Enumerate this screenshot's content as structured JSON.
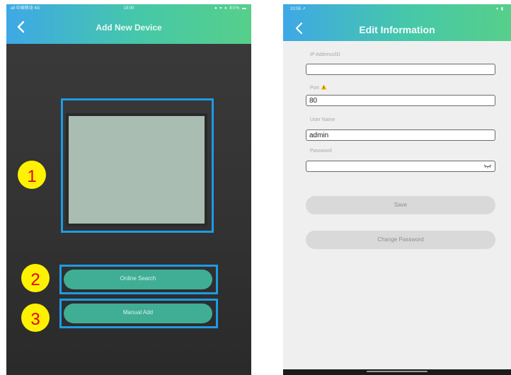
{
  "left_screen": {
    "status": {
      "carrier": "all 中国移动 4G",
      "time": "19:00",
      "icons": "● ▾ ● 80% ▬"
    },
    "title": "Add New Device",
    "buttons": {
      "online_search": "Online Search",
      "manual_add": "Manual Add"
    },
    "markers": [
      "1",
      "2",
      "3"
    ]
  },
  "right_screen": {
    "status": {
      "time": "10:55 ↗",
      "icons": "▾ ▮"
    },
    "title": "Edit Information",
    "fields": {
      "ip_label": "IP Address/ID",
      "ip_value": "",
      "port_label": "Port",
      "port_value": "80",
      "username_label": "User Name",
      "username_value": "admin",
      "password_label": "Password",
      "password_value": ""
    },
    "buttons": {
      "save": "Save",
      "change_password": "Change Password"
    }
  },
  "colors": {
    "header_gradient_start": "#3ea8e6",
    "header_gradient_end": "#57cf8a",
    "highlight_border": "#1e9be4",
    "pill_button": "#3fae95",
    "marker_bg": "#fff200",
    "marker_text": "#e60012",
    "warning": "#f5b800"
  }
}
